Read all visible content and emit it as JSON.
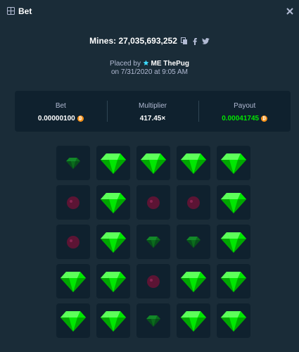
{
  "header": {
    "title": "Bet",
    "icon": "bet-grid-icon",
    "close_icon": "close-icon"
  },
  "bet_info": {
    "mines_label": "Mines: 27,035,693,252",
    "share_icons": [
      "copy-icon",
      "facebook-icon",
      "twitter-icon"
    ],
    "placed_by_prefix": "Placed by",
    "user_icon": "star-icon",
    "username": "ME ThePug",
    "placed_on": "on 7/31/2020 at 9:05 AM"
  },
  "stats": {
    "bet": {
      "label": "Bet",
      "value": "0.00000100"
    },
    "multiplier": {
      "label": "Multiplier",
      "value": "417.45×"
    },
    "payout": {
      "label": "Payout",
      "value": "0.00041745"
    },
    "currency_icon": "bitcoin-icon"
  },
  "colors": {
    "background": "#1a2c38",
    "panel": "#0f212e",
    "gem_bright": "#00e701",
    "gem_dim": "#0b6b1c",
    "mine_dim": "#5c1434",
    "payout": "#00e701",
    "coin": "#f7931a"
  },
  "tiles": [
    [
      "gem-dim",
      "gem",
      "gem",
      "gem",
      "gem"
    ],
    [
      "mine-dim",
      "gem",
      "mine-dim",
      "mine-dim",
      "gem"
    ],
    [
      "mine-dim",
      "gem",
      "gem-dim",
      "gem-dim",
      "gem"
    ],
    [
      "gem",
      "gem",
      "mine-dim",
      "gem",
      "gem"
    ],
    [
      "gem",
      "gem",
      "gem-dim",
      "gem",
      "gem"
    ]
  ]
}
